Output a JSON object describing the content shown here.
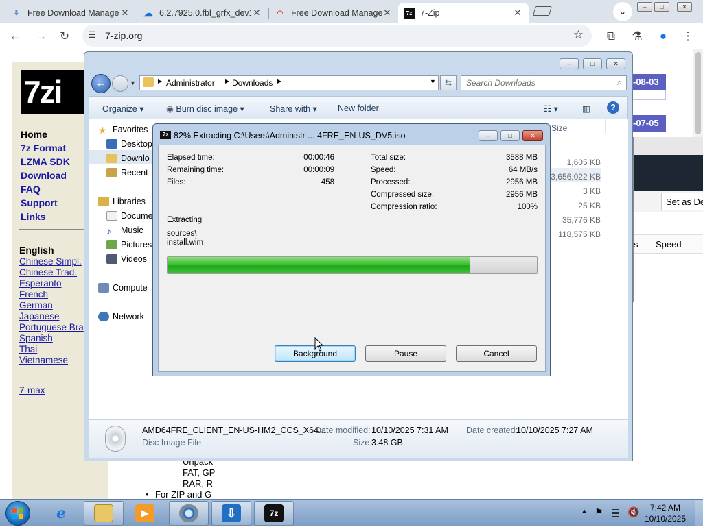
{
  "browser": {
    "tabs": [
      {
        "title": "Free Download Manage",
        "favicon": "fdm-icon",
        "active": false
      },
      {
        "title": "6.2.7925.0.fbl_grfx_dev1",
        "favicon": "cloud-icon",
        "active": false
      },
      {
        "title": "Free Download Manage",
        "favicon": "rainbow-icon",
        "active": false
      },
      {
        "title": "7-Zip",
        "favicon": "7zip-icon",
        "active": true
      }
    ],
    "url": "7-zip.org"
  },
  "website": {
    "logo_text": "7zi",
    "nav": [
      "Home",
      "7z Format",
      "LZMA SDK",
      "Download",
      "FAQ",
      "Support",
      "Links"
    ],
    "language_heading": "English",
    "languages": [
      "Chinese Simpl.",
      "Chinese Trad.",
      "Esperanto",
      "French",
      "German",
      "Japanese",
      "Portuguese Bra",
      "Spanish",
      "Thai",
      "Vietnamese"
    ],
    "extra_link": "7-max",
    "date_badges": [
      "-08-03",
      "-07-05"
    ],
    "bottom_text": [
      "Unpack",
      "FAT, GP",
      "RAR, R",
      "For ZIP and G"
    ]
  },
  "fdm_window": {
    "set_default_label": "Set as De",
    "col_s": "s",
    "col_speed": "Speed"
  },
  "explorer": {
    "breadcrumb": [
      "Administrator",
      "Downloads"
    ],
    "search_placeholder": "Search Downloads",
    "commands": [
      "Organize",
      "Burn disc image",
      "Share with",
      "New folder"
    ],
    "nav_items": {
      "favorites": "Favorites",
      "desktop": "Desktop",
      "downloads": "Downlo",
      "recent": "Recent",
      "libraries": "Libraries",
      "documents": "Docume",
      "music": "Music",
      "pictures": "Pictures",
      "videos": "Videos",
      "computer": "Compute",
      "network": "Network"
    },
    "size_header": "Size",
    "sizes": [
      "1,605 KB",
      "3,656,022 KB",
      "3 KB",
      "25 KB",
      "35,776 KB",
      "118,575 KB"
    ],
    "details": {
      "filename": "AMD64FRE_CLIENT_EN-US-HM2_CCS_X64...",
      "filetype": "Disc Image File",
      "date_modified_label": "Date modified:",
      "date_modified": "10/10/2025 7:31 AM",
      "date_created_label": "Date created:",
      "date_created": "10/10/2025 7:27 AM",
      "size_label": "Size:",
      "size": "3.48 GB"
    }
  },
  "zip_dialog": {
    "title": "82% Extracting C:\\Users\\Administr ... 4FRE_EN-US_DV5.iso",
    "left": [
      {
        "label": "Elapsed time:",
        "value": "00:00:46"
      },
      {
        "label": "Remaining time:",
        "value": "00:00:09"
      },
      {
        "label": "Files:",
        "value": "458"
      }
    ],
    "right": [
      {
        "label": "Total size:",
        "value": "3588 MB"
      },
      {
        "label": "Speed:",
        "value": "64 MB/s"
      },
      {
        "label": "Processed:",
        "value": "2956 MB"
      },
      {
        "label": "Compressed size:",
        "value": "2956 MB"
      },
      {
        "label": "Compression ratio:",
        "value": "100%"
      }
    ],
    "status": "Extracting",
    "current_dir": "sources\\",
    "current_file": "install.wim",
    "progress_fraction": 0.82,
    "buttons": {
      "background": "Background",
      "pause": "Pause",
      "cancel": "Cancel"
    }
  },
  "taskbar": {
    "time": "7:42 AM",
    "date": "10/10/2025"
  }
}
